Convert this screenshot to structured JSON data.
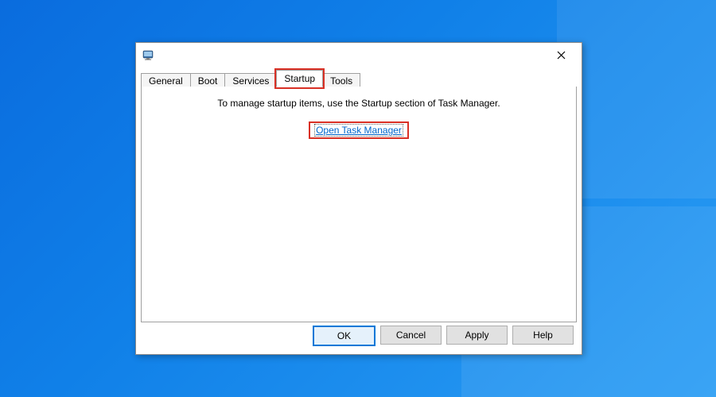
{
  "tabs": {
    "general": "General",
    "boot": "Boot",
    "services": "Services",
    "startup": "Startup",
    "tools": "Tools"
  },
  "content": {
    "info": "To manage startup items, use the Startup section of Task Manager.",
    "link": "Open Task Manager"
  },
  "buttons": {
    "ok": "OK",
    "cancel": "Cancel",
    "apply": "Apply",
    "help": "Help"
  }
}
